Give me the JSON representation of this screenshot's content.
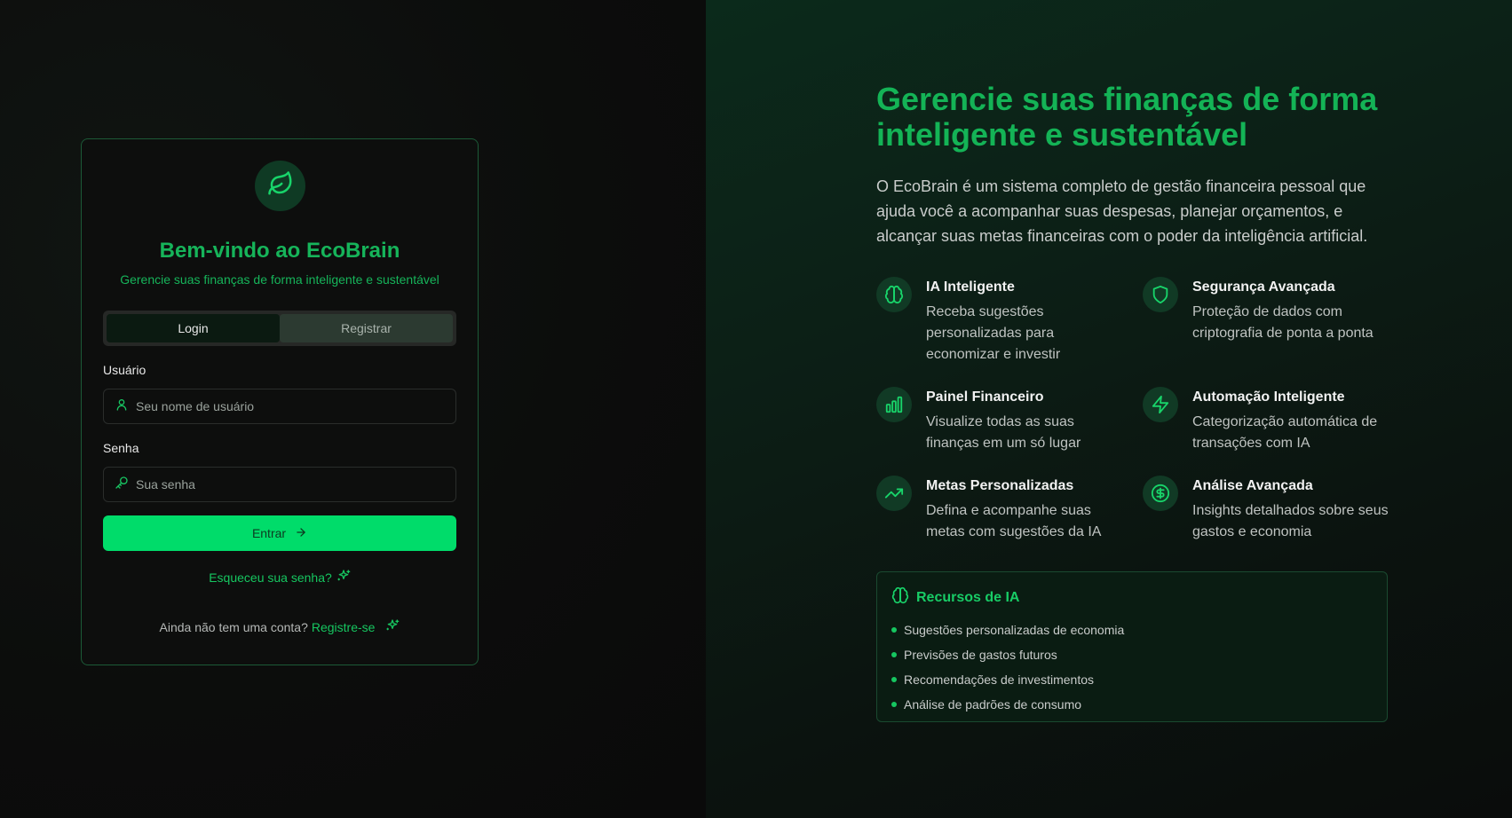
{
  "login": {
    "title": "Bem-vindo ao EcoBrain",
    "subtitle": "Gerencie suas finanças de forma inteligente e sustentável",
    "tabs": [
      {
        "label": "Login",
        "active": true
      },
      {
        "label": "Registrar",
        "active": false
      }
    ],
    "username": {
      "label": "Usuário",
      "placeholder": "Seu nome de usuário",
      "value": ""
    },
    "password": {
      "label": "Senha",
      "placeholder": "Sua senha",
      "value": ""
    },
    "submit_label": "Entrar",
    "forgot_label": "Esqueceu sua senha?",
    "signup_prompt": "Ainda não tem uma conta?",
    "signup_link": "Registre-se"
  },
  "hero": {
    "title": "Gerencie suas finanças de forma inteligente e sustentável",
    "description": "O EcoBrain é um sistema completo de gestão financeira pessoal que ajuda você a acompanhar suas despesas, planejar orçamentos, e alcançar suas metas financeiras com o poder da inteligência artificial."
  },
  "features": [
    {
      "icon": "brain-icon",
      "title": "IA Inteligente",
      "description": "Receba sugestões personalizadas para economizar e investir"
    },
    {
      "icon": "shield-icon",
      "title": "Segurança Avançada",
      "description": "Proteção de dados com criptografia de ponta a ponta"
    },
    {
      "icon": "bar-chart-icon",
      "title": "Painel Financeiro",
      "description": "Visualize todas as suas finanças em um só lugar"
    },
    {
      "icon": "lightning-icon",
      "title": "Automação Inteligente",
      "description": "Categorização automática de transações com IA"
    },
    {
      "icon": "trending-up-icon",
      "title": "Metas Personalizadas",
      "description": "Defina e acompanhe suas metas com sugestões da IA"
    },
    {
      "icon": "dollar-circle-icon",
      "title": "Análise Avançada",
      "description": "Insights detalhados sobre seus gastos e economia"
    }
  ],
  "ai_resources": {
    "title": "Recursos de IA",
    "items": [
      "Sugestões personalizadas de economia",
      "Previsões de gastos futuros",
      "Recomendações de investimentos",
      "Análise de padrões de consumo"
    ]
  },
  "colors": {
    "accent": "#00dc6a",
    "accent_text": "#16b45a",
    "card_border": "#1c5a37"
  }
}
